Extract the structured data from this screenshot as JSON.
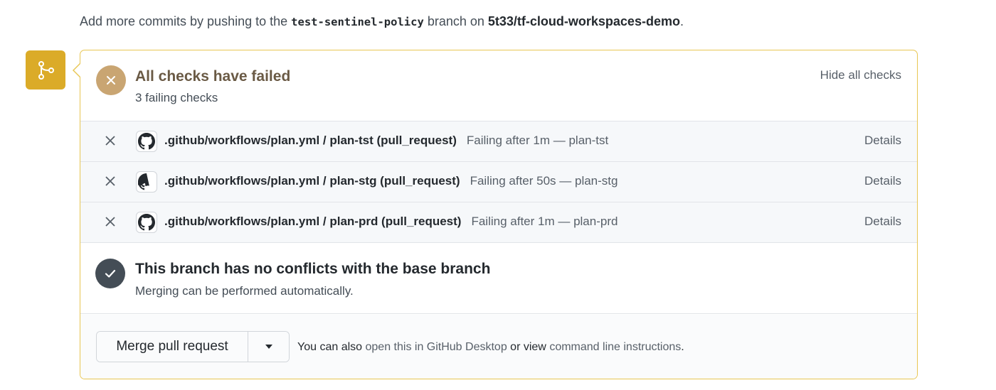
{
  "intro": {
    "prefix": "Add more commits by pushing to the",
    "branch": "test-sentinel-policy",
    "middle": "branch on",
    "repo": "5t33/tf-cloud-workspaces-demo",
    "suffix": "."
  },
  "checks": {
    "title": "All checks have failed",
    "subtitle": "3 failing checks",
    "toggle_label": "Hide all checks",
    "items": [
      {
        "name": ".github/workflows/plan.yml / plan-tst (pull_request)",
        "detail": "Failing after 1m — plan-tst",
        "link": "Details"
      },
      {
        "name": ".github/workflows/plan.yml / plan-stg (pull_request)",
        "detail": "Failing after 50s — plan-stg",
        "link": "Details"
      },
      {
        "name": ".github/workflows/plan.yml / plan-prd (pull_request)",
        "detail": "Failing after 1m — plan-prd",
        "link": "Details"
      }
    ]
  },
  "conflicts": {
    "title": "This branch has no conflicts with the base branch",
    "subtitle": "Merging can be performed automatically."
  },
  "merge": {
    "button_label": "Merge pull request",
    "hint_prefix": "You can also",
    "desktop_link": "open this in GitHub Desktop",
    "hint_middle": "or view",
    "cli_link": "command line instructions",
    "hint_suffix": "."
  },
  "colors": {
    "accent": "#dbab28",
    "border": "#e8c653",
    "failed_avatar": "#c9a572",
    "success_avatar": "#444d56"
  }
}
